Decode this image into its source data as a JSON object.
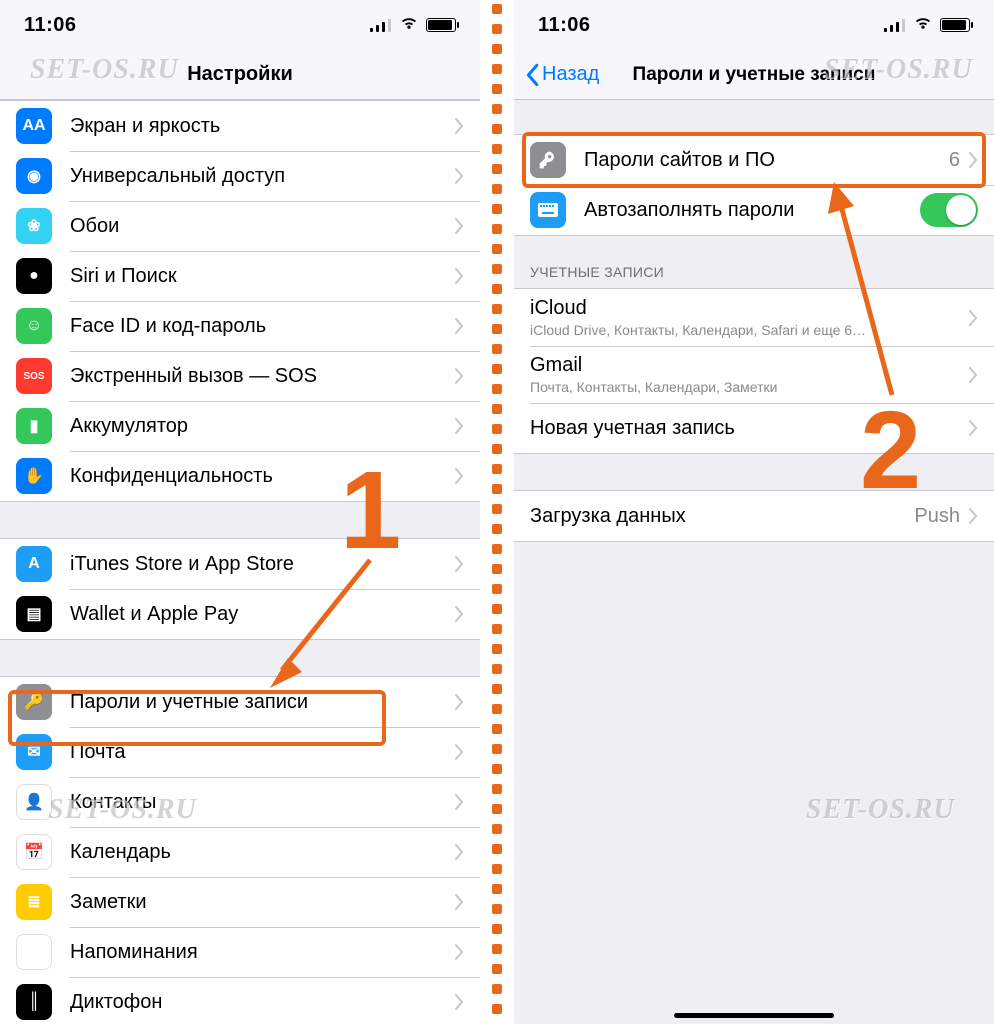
{
  "status": {
    "time": "11:06"
  },
  "left": {
    "title": "Настройки",
    "items": [
      {
        "label": "Экран и яркость",
        "icon": "display-icon",
        "color": "c-blue",
        "glyph": "AA"
      },
      {
        "label": "Универсальный доступ",
        "icon": "accessibility-icon",
        "color": "c-blue",
        "glyph": "◉"
      },
      {
        "label": "Обои",
        "icon": "wallpaper-icon",
        "color": "c-cyan",
        "glyph": "❀"
      },
      {
        "label": "Siri и Поиск",
        "icon": "siri-icon",
        "color": "c-black",
        "glyph": "●"
      },
      {
        "label": "Face ID и код-пароль",
        "icon": "faceid-icon",
        "color": "c-green",
        "glyph": "☺"
      },
      {
        "label": "Экстренный вызов — SOS",
        "icon": "sos-icon",
        "color": "c-red",
        "glyph": "SOS"
      },
      {
        "label": "Аккумулятор",
        "icon": "battery-icon",
        "color": "c-green",
        "glyph": "▮"
      },
      {
        "label": "Конфиденциальность",
        "icon": "privacy-icon",
        "color": "c-blue",
        "glyph": "✋"
      }
    ],
    "items2": [
      {
        "label": "iTunes Store и App Store",
        "icon": "appstore-icon",
        "color": "c-azure",
        "glyph": "A"
      },
      {
        "label": "Wallet и Apple Pay",
        "icon": "wallet-icon",
        "color": "c-black",
        "glyph": "▤"
      }
    ],
    "items3": [
      {
        "label": "Пароли и учетные записи",
        "icon": "key-icon",
        "color": "c-gray",
        "glyph": "🔑"
      },
      {
        "label": "Почта",
        "icon": "mail-icon",
        "color": "c-azure",
        "glyph": "✉"
      },
      {
        "label": "Контакты",
        "icon": "contacts-icon",
        "color": "c-white",
        "glyph": "👤"
      },
      {
        "label": "Календарь",
        "icon": "calendar-icon",
        "color": "c-white",
        "glyph": "📅"
      },
      {
        "label": "Заметки",
        "icon": "notes-icon",
        "color": "c-yellow",
        "glyph": "≣"
      },
      {
        "label": "Напоминания",
        "icon": "reminders-icon",
        "color": "c-white",
        "glyph": "⋮"
      },
      {
        "label": "Диктофон",
        "icon": "voice-icon",
        "color": "c-black",
        "glyph": "║"
      }
    ]
  },
  "right": {
    "back": "Назад",
    "title": "Пароли и учетные записи",
    "passwords": {
      "label": "Пароли сайтов и ПО",
      "count": "6",
      "icon": "key-icon"
    },
    "autofill": {
      "label": "Автозаполнять пароли",
      "icon": "keyboard-icon"
    },
    "accounts_header": "УЧЕТНЫЕ ЗАПИСИ",
    "accounts": [
      {
        "name": "iCloud",
        "sub": "iCloud Drive, Контакты, Календари, Safari и еще 6…"
      },
      {
        "name": "Gmail",
        "sub": "Почта, Контакты, Календари, Заметки"
      },
      {
        "name": "Новая учетная запись",
        "sub": ""
      }
    ],
    "fetch": {
      "label": "Загрузка данных",
      "detail": "Push"
    }
  },
  "annotations": {
    "num1": "1",
    "num2": "2"
  },
  "watermark": "SET-OS.RU"
}
